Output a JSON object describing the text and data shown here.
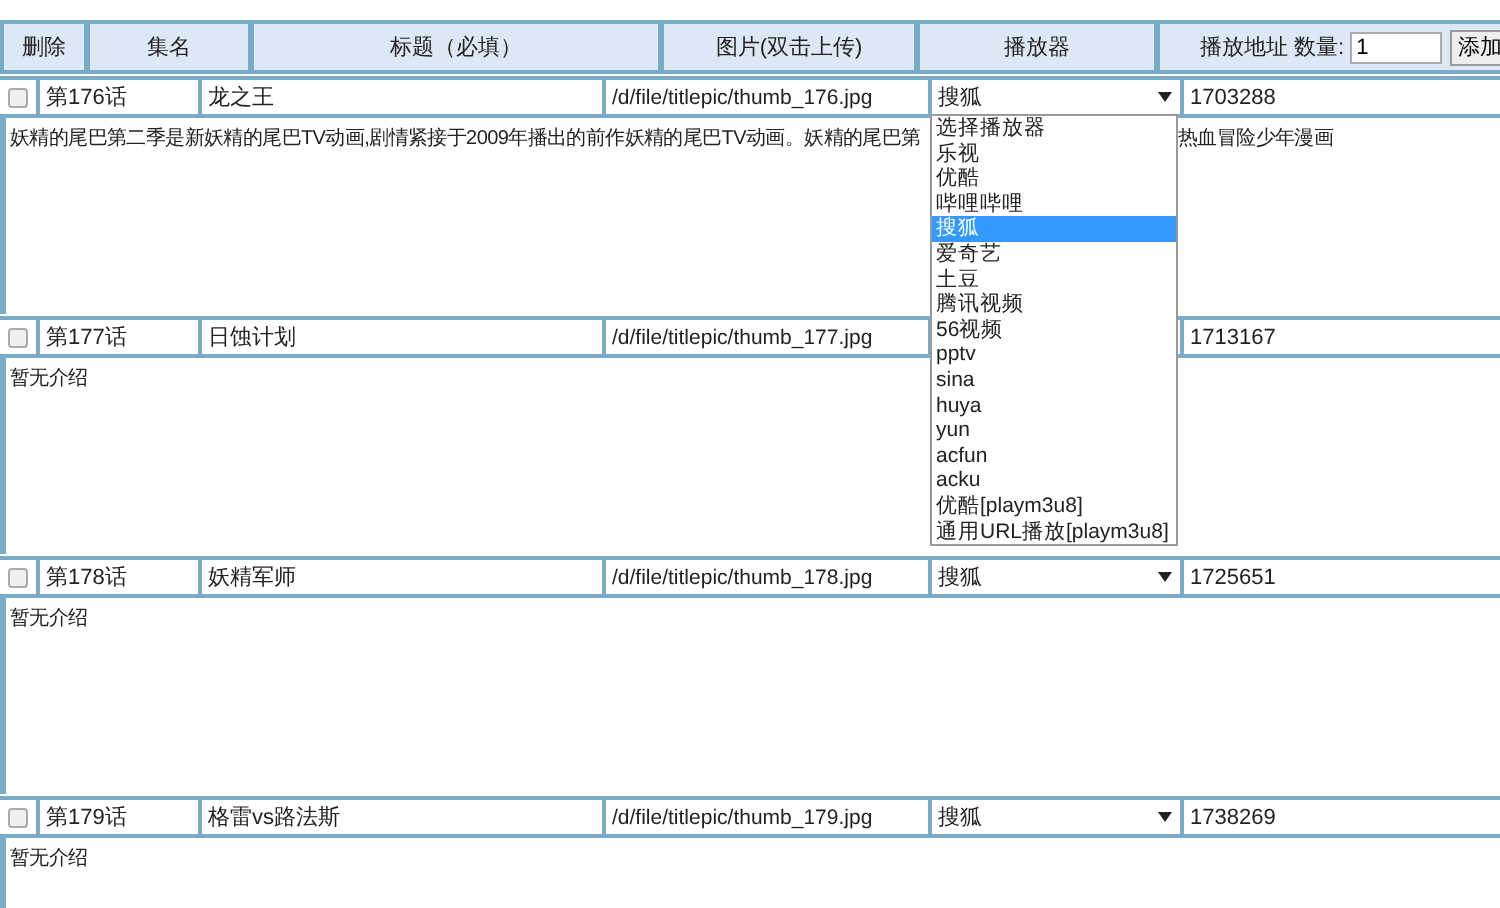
{
  "header": {
    "columns": [
      "删除",
      "集名",
      "标题（必填）",
      "图片(双击上传)",
      "播放器"
    ],
    "address_label": "播放地址 数量:",
    "count_value": "1",
    "add_button": "添加"
  },
  "rows": [
    {
      "checked": false,
      "episode": "第176话",
      "title": "龙之王",
      "image": "/d/file/titlepic/thumb_176.jpg",
      "player": "搜狐",
      "address": "1703288",
      "description": [
        "妖精的尾巴第二季是新妖精的尾巴TV动画,剧情紧接于2009年播出的前作妖精的尾巴TV动画。妖精的尾巴第",
        "热血冒险少年漫画"
      ],
      "dropdown_open": true
    },
    {
      "checked": false,
      "episode": "第177话",
      "title": "日蚀计划",
      "image": "/d/file/titlepic/thumb_177.jpg",
      "address": "1713167",
      "description": [
        "暂无介绍"
      ],
      "dropdown_open": false
    },
    {
      "checked": false,
      "episode": "第178话",
      "title": "妖精军师",
      "image": "/d/file/titlepic/thumb_178.jpg",
      "player": "搜狐",
      "address": "1725651",
      "description": [
        "暂无介绍"
      ],
      "dropdown_open": false
    },
    {
      "checked": false,
      "episode": "第179话",
      "title": "格雷vs路法斯",
      "image": "/d/file/titlepic/thumb_179.jpg",
      "player": "搜狐",
      "address": "1738269",
      "description": [
        "暂无介绍"
      ],
      "dropdown_open": false
    }
  ],
  "player_options": [
    {
      "label": "选择播放器",
      "selected": false
    },
    {
      "label": "乐视",
      "selected": false
    },
    {
      "label": "优酷",
      "selected": false
    },
    {
      "label": "哔哩哔哩",
      "selected": false
    },
    {
      "label": "搜狐",
      "selected": true
    },
    {
      "label": "爱奇艺",
      "selected": false
    },
    {
      "label": "土豆",
      "selected": false
    },
    {
      "label": "腾讯视频",
      "selected": false
    },
    {
      "label": "56视频",
      "selected": false
    },
    {
      "label": "pptv",
      "selected": false
    },
    {
      "label": "sina",
      "selected": false
    },
    {
      "label": "huya",
      "selected": false
    },
    {
      "label": "yun",
      "selected": false
    },
    {
      "label": "acfun",
      "selected": false
    },
    {
      "label": "acku",
      "selected": false
    },
    {
      "label": "优酷[playm3u8]",
      "selected": false
    },
    {
      "label": "通用URL播放[playm3u8]",
      "selected": false
    }
  ]
}
